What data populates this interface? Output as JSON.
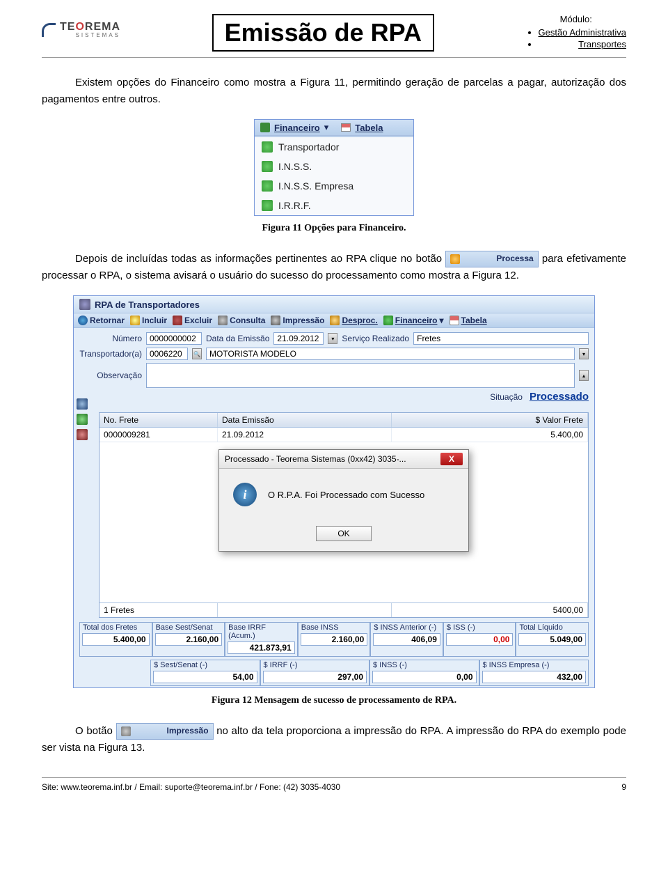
{
  "header": {
    "logo_text": "TEOREMA",
    "logo_sub": "SISTEMAS",
    "page_title": "Emissão de RPA",
    "modulo_label": "Módulo:",
    "modulo_items": [
      "Gestão Administrativa",
      "Transportes"
    ]
  },
  "para1": "Existem opções do Financeiro como mostra a Figura 11, permitindo geração de parcelas a pagar, autorização dos pagamentos entre outros.",
  "fig11": {
    "fin_label": "Financeiro",
    "arrow": "▾",
    "tabela_label": "Tabela",
    "items": [
      "Transportador",
      "I.N.S.S.",
      "I.N.S.S. Empresa",
      "I.R.R.F."
    ],
    "caption": "Figura 11 Opções para Financeiro."
  },
  "para2_a": "Depois de incluídas todas as informações pertinentes ao RPA clique no botão ",
  "btn_processa": "Processa",
  "para2_b": " para efetivamente processar o RPA, o sistema avisará o usuário do sucesso do processamento como mostra a Figura 12.",
  "fig12": {
    "title": "RPA de Transportadores",
    "toolbar": {
      "retornar": "Retornar",
      "incluir": "Incluir",
      "excluir": "Excluir",
      "consulta": "Consulta",
      "impressao": "Impressão",
      "desproc": "Desproc.",
      "financeiro": "Financeiro",
      "tabela": "Tabela"
    },
    "form": {
      "numero_label": "Número",
      "numero": "0000000002",
      "data_label": "Data da Emissão",
      "data": "21.09.2012",
      "servico_label": "Serviço Realizado",
      "servico": "Fretes",
      "transp_label": "Transportador(a)",
      "transp_cod": "0006220",
      "transp_nome": "MOTORISTA MODELO",
      "obs_label": "Observação",
      "sit_label": "Situação",
      "sit_val": "Processado"
    },
    "grid": {
      "h_nofrete": "No. Frete",
      "h_data": "Data Emissão",
      "h_valor": "$ Valor Frete",
      "row_no": "0000009281",
      "row_data": "21.09.2012",
      "row_valor": "5.400,00",
      "foot_count": "1 Fretes",
      "foot_total": "5400,00"
    },
    "dialog": {
      "title": "Processado - Teorema Sistemas (0xx42) 3035-...",
      "close": "X",
      "info": "i",
      "msg": "O R.P.A. Foi Processado com Sucesso",
      "ok": "OK"
    },
    "totals1": {
      "total_fretes_lbl": "Total dos Fretes",
      "total_fretes": "5.400,00",
      "base_sest_lbl": "Base Sest/Senat",
      "base_sest": "2.160,00",
      "base_irrf_lbl": "Base IRRF (Acum.)",
      "base_irrf": "421.873,91",
      "base_inss_lbl": "Base INSS",
      "base_inss": "2.160,00",
      "inss_ant_lbl": "$ INSS Anterior (-)",
      "inss_ant": "406,09",
      "iss_lbl": "$ ISS (-)",
      "iss": "0,00",
      "total_liq_lbl": "Total Líquido",
      "total_liq": "5.049,00"
    },
    "totals2": {
      "sest_lbl": "$ Sest/Senat (-)",
      "sest": "54,00",
      "irrf_lbl": "$ IRRF (-)",
      "irrf": "297,00",
      "inss_lbl": "$ INSS (-)",
      "inss": "0,00",
      "inss_emp_lbl": "$ INSS Empresa (-)",
      "inss_emp": "432,00"
    },
    "caption": "Figura 12 Mensagem de sucesso de processamento de RPA."
  },
  "para3_a": "O botão ",
  "btn_impressao": "Impressão",
  "para3_b": " no alto da tela proporciona a impressão do RPA. A impressão do RPA do exemplo pode ser vista na Figura 13.",
  "footer": {
    "left": "Site: www.teorema.inf.br / Email: suporte@teorema.inf.br / Fone: (42) 3035-4030",
    "right": "9"
  }
}
